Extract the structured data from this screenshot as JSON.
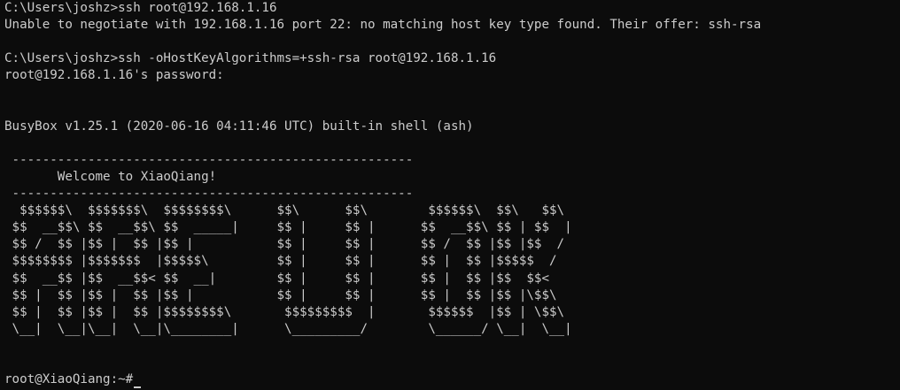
{
  "terminal": {
    "lines": [
      "C:\\Users\\joshz>ssh root@192.168.1.16",
      "Unable to negotiate with 192.168.1.16 port 22: no matching host key type found. Their offer: ssh-rsa",
      "",
      "C:\\Users\\joshz>ssh -oHostKeyAlgorithms=+ssh-rsa root@192.168.1.16",
      "root@192.168.1.16's password:",
      "",
      "",
      "BusyBox v1.25.1 (2020-06-16 04:11:46 UTC) built-in shell (ash)",
      "",
      " -----------------------------------------------------",
      "       Welcome to XiaoQiang!",
      " -----------------------------------------------------",
      "  $$$$$$\\  $$$$$$$\\  $$$$$$$$\\      $$\\      $$\\        $$$$$$\\  $$\\   $$\\",
      " $$  __$$\\ $$  __$$\\ $$  _____|     $$ |     $$ |      $$  __$$\\ $$ | $$  |",
      " $$ /  $$ |$$ |  $$ |$$ |           $$ |     $$ |      $$ /  $$ |$$ |$$  /",
      " $$$$$$$$ |$$$$$$$  |$$$$$\\         $$ |     $$ |      $$ |  $$ |$$$$$  /",
      " $$  __$$ |$$  __$$< $$  __|        $$ |     $$ |      $$ |  $$ |$$  $$<",
      " $$ |  $$ |$$ |  $$ |$$ |           $$ |     $$ |      $$ |  $$ |$$ |\\$$\\",
      " $$ |  $$ |$$ |  $$ |$$$$$$$$\\       $$$$$$$$$  |       $$$$$$  |$$ | \\$$\\",
      " \\__|  \\__|\\__|  \\__|\\________|      \\_________/        \\______/ \\__|  \\__|",
      "",
      "",
      "root@XiaoQiang:~#"
    ]
  }
}
